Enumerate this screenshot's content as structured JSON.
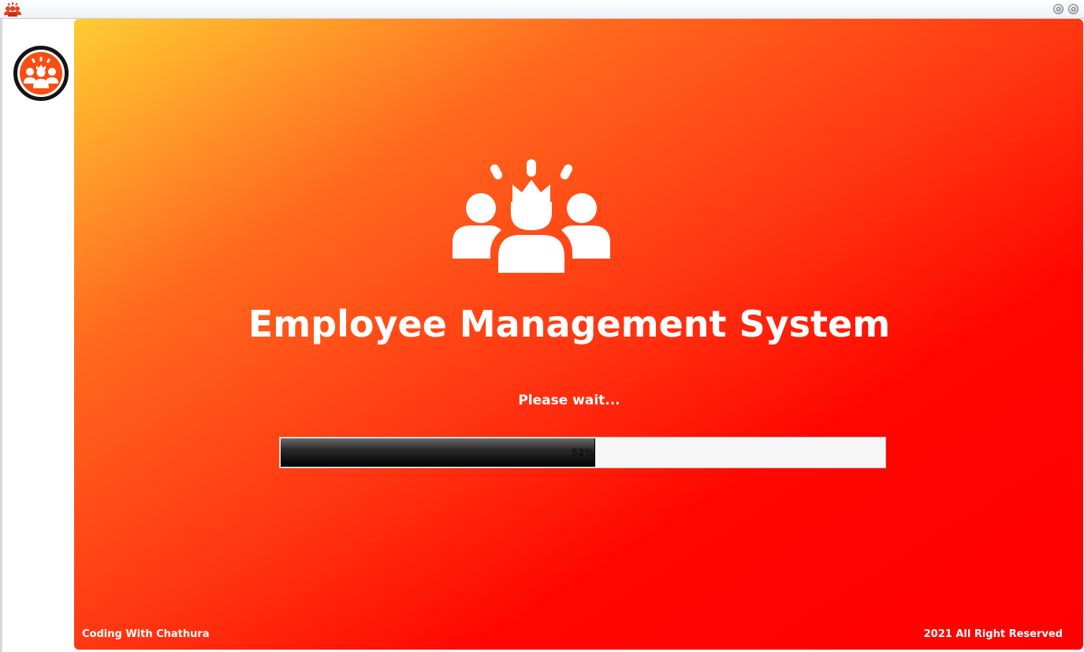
{
  "window": {
    "app_icon": "team-icon",
    "buttons": [
      "minimize-icon",
      "close-icon"
    ]
  },
  "sidebar": {
    "logo_icon": "team-leader-icon"
  },
  "splash": {
    "icon": "team-leader-icon",
    "title": "Employee Management System",
    "status_text": "Please wait...",
    "progress": {
      "value": 52,
      "label": "52%"
    },
    "footer_left": "Coding With Chathura",
    "footer_right": "2021 All Right Reserved"
  },
  "colors": {
    "gradient_start": "#ffcc33",
    "gradient_end": "#ff0000",
    "progress_fill": "#000000",
    "logo_orange": "#fb4c12"
  }
}
